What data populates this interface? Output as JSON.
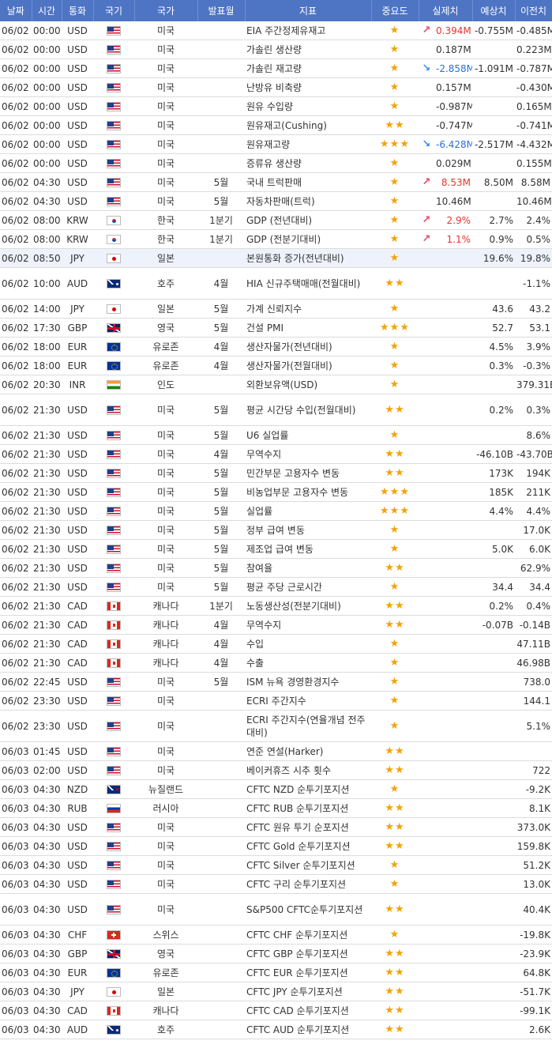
{
  "headers": {
    "date": "날짜",
    "time": "시간",
    "currency": "통화",
    "flag": "국기",
    "country": "국가",
    "period": "발표월",
    "indicator": "지표",
    "importance": "중요도",
    "actual": "실제치",
    "forecast": "예상치",
    "previous": "이전치"
  },
  "colors": {
    "header_bg": "#4e74c4",
    "star": "#f2a20a",
    "up_value": "#e8332f",
    "down_value": "#2c6fd6",
    "highlight_row": "#eef2fb"
  },
  "rows": [
    {
      "date": "06/02",
      "time": "00:00",
      "cur": "USD",
      "flag": "us",
      "flag_icon": "us-flag-icon",
      "country": "미국",
      "period": "",
      "indicator": "EIA 주간정제유재고",
      "stars": "★",
      "arrow": "↗",
      "trend": "up",
      "actual": "0.394M",
      "forecast": "-0.755M",
      "previous": "-0.485M"
    },
    {
      "date": "06/02",
      "time": "00:00",
      "cur": "USD",
      "flag": "us",
      "flag_icon": "us-flag-icon",
      "country": "미국",
      "period": "",
      "indicator": "가솔린 생산량",
      "stars": "★",
      "arrow": "",
      "trend": "",
      "actual": "0.187M",
      "forecast": "",
      "previous": "0.223M"
    },
    {
      "date": "06/02",
      "time": "00:00",
      "cur": "USD",
      "flag": "us",
      "flag_icon": "us-flag-icon",
      "country": "미국",
      "period": "",
      "indicator": "가솔린 재고량",
      "stars": "★",
      "arrow": "↘",
      "trend": "down",
      "actual": "-2.858M",
      "forecast": "-1.091M",
      "previous": "-0.787M"
    },
    {
      "date": "06/02",
      "time": "00:00",
      "cur": "USD",
      "flag": "us",
      "flag_icon": "us-flag-icon",
      "country": "미국",
      "period": "",
      "indicator": "난방유 비축량",
      "stars": "★",
      "arrow": "",
      "trend": "",
      "actual": "0.157M",
      "forecast": "",
      "previous": "-0.430M"
    },
    {
      "date": "06/02",
      "time": "00:00",
      "cur": "USD",
      "flag": "us",
      "flag_icon": "us-flag-icon",
      "country": "미국",
      "period": "",
      "indicator": "원유 수입량",
      "stars": "★",
      "arrow": "",
      "trend": "",
      "actual": "-0.987M",
      "forecast": "",
      "previous": "0.165M"
    },
    {
      "date": "06/02",
      "time": "00:00",
      "cur": "USD",
      "flag": "us",
      "flag_icon": "us-flag-icon",
      "country": "미국",
      "period": "",
      "indicator": "원유재고(Cushing)",
      "stars": "★★",
      "arrow": "",
      "trend": "",
      "actual": "-0.747M",
      "forecast": "",
      "previous": "-0.741M"
    },
    {
      "date": "06/02",
      "time": "00:00",
      "cur": "USD",
      "flag": "us",
      "flag_icon": "us-flag-icon",
      "country": "미국",
      "period": "",
      "indicator": "원유재고량",
      "stars": "★★★",
      "arrow": "↘",
      "trend": "down",
      "actual": "-6.428M",
      "forecast": "-2.517M",
      "previous": "-4.432M"
    },
    {
      "date": "06/02",
      "time": "00:00",
      "cur": "USD",
      "flag": "us",
      "flag_icon": "us-flag-icon",
      "country": "미국",
      "period": "",
      "indicator": "증류유 생산량",
      "stars": "★",
      "arrow": "",
      "trend": "",
      "actual": "0.029M",
      "forecast": "",
      "previous": "0.155M"
    },
    {
      "date": "06/02",
      "time": "04:30",
      "cur": "USD",
      "flag": "us",
      "flag_icon": "us-flag-icon",
      "country": "미국",
      "period": "5월",
      "indicator": "국내 트럭판매",
      "stars": "★",
      "arrow": "↗",
      "trend": "up",
      "actual": "8.53M",
      "forecast": "8.50M",
      "previous": "8.58M"
    },
    {
      "date": "06/02",
      "time": "04:30",
      "cur": "USD",
      "flag": "us",
      "flag_icon": "us-flag-icon",
      "country": "미국",
      "period": "5월",
      "indicator": "자동차판매(트럭)",
      "stars": "★",
      "arrow": "",
      "trend": "",
      "actual": "10.46M",
      "forecast": "",
      "previous": "10.46M"
    },
    {
      "date": "06/02",
      "time": "08:00",
      "cur": "KRW",
      "flag": "kr",
      "flag_icon": "kr-flag-icon",
      "country": "한국",
      "period": "1분기",
      "indicator": "GDP (전년대비)",
      "stars": "★",
      "arrow": "↗",
      "trend": "up",
      "actual": "2.9%",
      "forecast": "2.7%",
      "previous": "2.4%"
    },
    {
      "date": "06/02",
      "time": "08:00",
      "cur": "KRW",
      "flag": "kr",
      "flag_icon": "kr-flag-icon",
      "country": "한국",
      "period": "1분기",
      "indicator": "GDP (전분기대비)",
      "stars": "★",
      "arrow": "↗",
      "trend": "up",
      "actual": "1.1%",
      "forecast": "0.9%",
      "previous": "0.5%"
    },
    {
      "date": "06/02",
      "time": "08:50",
      "cur": "JPY",
      "flag": "jp",
      "flag_icon": "jp-flag-icon",
      "country": "일본",
      "period": "",
      "indicator": "본원통화 증가(전년대비)",
      "stars": "★",
      "arrow": "",
      "trend": "",
      "actual": "",
      "forecast": "19.6%",
      "previous": "19.8%",
      "hl": true
    },
    {
      "date": "06/02",
      "time": "10:00",
      "cur": "AUD",
      "flag": "au",
      "flag_icon": "au-flag-icon",
      "country": "호주",
      "period": "4월",
      "indicator": "HIA 신규주택매매(전월대비)",
      "stars": "★★",
      "arrow": "",
      "trend": "",
      "actual": "",
      "forecast": "",
      "previous": "-1.1%",
      "tall": true
    },
    {
      "date": "06/02",
      "time": "14:00",
      "cur": "JPY",
      "flag": "jp",
      "flag_icon": "jp-flag-icon",
      "country": "일본",
      "period": "5월",
      "indicator": "가계 신뢰지수",
      "stars": "★",
      "arrow": "",
      "trend": "",
      "actual": "",
      "forecast": "43.6",
      "previous": "43.2"
    },
    {
      "date": "06/02",
      "time": "17:30",
      "cur": "GBP",
      "flag": "gb",
      "flag_icon": "gb-flag-icon",
      "country": "영국",
      "period": "5월",
      "indicator": "건설 PMI",
      "stars": "★★★",
      "arrow": "",
      "trend": "",
      "actual": "",
      "forecast": "52.7",
      "previous": "53.1"
    },
    {
      "date": "06/02",
      "time": "18:00",
      "cur": "EUR",
      "flag": "eu",
      "flag_icon": "eu-flag-icon",
      "country": "유로존",
      "period": "4월",
      "indicator": "생산자물가(전년대비)",
      "stars": "★",
      "arrow": "",
      "trend": "",
      "actual": "",
      "forecast": "4.5%",
      "previous": "3.9%"
    },
    {
      "date": "06/02",
      "time": "18:00",
      "cur": "EUR",
      "flag": "eu",
      "flag_icon": "eu-flag-icon",
      "country": "유로존",
      "period": "4월",
      "indicator": "생산자물가(전월대비)",
      "stars": "★",
      "arrow": "",
      "trend": "",
      "actual": "",
      "forecast": "0.3%",
      "previous": "-0.3%"
    },
    {
      "date": "06/02",
      "time": "20:30",
      "cur": "INR",
      "flag": "in",
      "flag_icon": "in-flag-icon",
      "country": "인도",
      "period": "",
      "indicator": "외환보유액(USD)",
      "stars": "★",
      "arrow": "",
      "trend": "",
      "actual": "",
      "forecast": "",
      "previous": "379.31B"
    },
    {
      "date": "06/02",
      "time": "21:30",
      "cur": "USD",
      "flag": "us",
      "flag_icon": "us-flag-icon",
      "country": "미국",
      "period": "5월",
      "indicator": "평균 시간당 수입(전월대비)",
      "stars": "★★",
      "arrow": "",
      "trend": "",
      "actual": "",
      "forecast": "0.2%",
      "previous": "0.3%",
      "tall": true
    },
    {
      "date": "06/02",
      "time": "21:30",
      "cur": "USD",
      "flag": "us",
      "flag_icon": "us-flag-icon",
      "country": "미국",
      "period": "5월",
      "indicator": "U6 실업률",
      "stars": "★",
      "arrow": "",
      "trend": "",
      "actual": "",
      "forecast": "",
      "previous": "8.6%"
    },
    {
      "date": "06/02",
      "time": "21:30",
      "cur": "USD",
      "flag": "us",
      "flag_icon": "us-flag-icon",
      "country": "미국",
      "period": "4월",
      "indicator": "무역수지",
      "stars": "★★",
      "arrow": "",
      "trend": "",
      "actual": "",
      "forecast": "-46.10B",
      "previous": "-43.70B"
    },
    {
      "date": "06/02",
      "time": "21:30",
      "cur": "USD",
      "flag": "us",
      "flag_icon": "us-flag-icon",
      "country": "미국",
      "period": "5월",
      "indicator": "민간부문 고용자수 변동",
      "stars": "★★",
      "arrow": "",
      "trend": "",
      "actual": "",
      "forecast": "173K",
      "previous": "194K"
    },
    {
      "date": "06/02",
      "time": "21:30",
      "cur": "USD",
      "flag": "us",
      "flag_icon": "us-flag-icon",
      "country": "미국",
      "period": "5월",
      "indicator": "비농업부문 고용자수 변동",
      "stars": "★★★",
      "arrow": "",
      "trend": "",
      "actual": "",
      "forecast": "185K",
      "previous": "211K"
    },
    {
      "date": "06/02",
      "time": "21:30",
      "cur": "USD",
      "flag": "us",
      "flag_icon": "us-flag-icon",
      "country": "미국",
      "period": "5월",
      "indicator": "실업률",
      "stars": "★★★",
      "arrow": "",
      "trend": "",
      "actual": "",
      "forecast": "4.4%",
      "previous": "4.4%"
    },
    {
      "date": "06/02",
      "time": "21:30",
      "cur": "USD",
      "flag": "us",
      "flag_icon": "us-flag-icon",
      "country": "미국",
      "period": "5월",
      "indicator": "정부 급여 변동",
      "stars": "★",
      "arrow": "",
      "trend": "",
      "actual": "",
      "forecast": "",
      "previous": "17.0K"
    },
    {
      "date": "06/02",
      "time": "21:30",
      "cur": "USD",
      "flag": "us",
      "flag_icon": "us-flag-icon",
      "country": "미국",
      "period": "5월",
      "indicator": "제조업 급여 변동",
      "stars": "★",
      "arrow": "",
      "trend": "",
      "actual": "",
      "forecast": "5.0K",
      "previous": "6.0K"
    },
    {
      "date": "06/02",
      "time": "21:30",
      "cur": "USD",
      "flag": "us",
      "flag_icon": "us-flag-icon",
      "country": "미국",
      "period": "5월",
      "indicator": "참여율",
      "stars": "★★",
      "arrow": "",
      "trend": "",
      "actual": "",
      "forecast": "",
      "previous": "62.9%"
    },
    {
      "date": "06/02",
      "time": "21:30",
      "cur": "USD",
      "flag": "us",
      "flag_icon": "us-flag-icon",
      "country": "미국",
      "period": "5월",
      "indicator": "평균 주당 근로시간",
      "stars": "★",
      "arrow": "",
      "trend": "",
      "actual": "",
      "forecast": "34.4",
      "previous": "34.4"
    },
    {
      "date": "06/02",
      "time": "21:30",
      "cur": "CAD",
      "flag": "ca",
      "flag_icon": "ca-flag-icon",
      "country": "캐나다",
      "period": "1분기",
      "indicator": "노동생산성(전분기대비)",
      "stars": "★★",
      "arrow": "",
      "trend": "",
      "actual": "",
      "forecast": "0.2%",
      "previous": "0.4%"
    },
    {
      "date": "06/02",
      "time": "21:30",
      "cur": "CAD",
      "flag": "ca",
      "flag_icon": "ca-flag-icon",
      "country": "캐나다",
      "period": "4월",
      "indicator": "무역수지",
      "stars": "★★",
      "arrow": "",
      "trend": "",
      "actual": "",
      "forecast": "-0.07B",
      "previous": "-0.14B"
    },
    {
      "date": "06/02",
      "time": "21:30",
      "cur": "CAD",
      "flag": "ca",
      "flag_icon": "ca-flag-icon",
      "country": "캐나다",
      "period": "4월",
      "indicator": "수입",
      "stars": "★",
      "arrow": "",
      "trend": "",
      "actual": "",
      "forecast": "",
      "previous": "47.11B"
    },
    {
      "date": "06/02",
      "time": "21:30",
      "cur": "CAD",
      "flag": "ca",
      "flag_icon": "ca-flag-icon",
      "country": "캐나다",
      "period": "4월",
      "indicator": "수출",
      "stars": "★",
      "arrow": "",
      "trend": "",
      "actual": "",
      "forecast": "",
      "previous": "46.98B"
    },
    {
      "date": "06/02",
      "time": "22:45",
      "cur": "USD",
      "flag": "us",
      "flag_icon": "us-flag-icon",
      "country": "미국",
      "period": "5월",
      "indicator": "ISM 뉴욕 경영환경지수",
      "stars": "★",
      "arrow": "",
      "trend": "",
      "actual": "",
      "forecast": "",
      "previous": "738.0"
    },
    {
      "date": "06/02",
      "time": "23:30",
      "cur": "USD",
      "flag": "us",
      "flag_icon": "us-flag-icon",
      "country": "미국",
      "period": "",
      "indicator": "ECRI 주간지수",
      "stars": "★",
      "arrow": "",
      "trend": "",
      "actual": "",
      "forecast": "",
      "previous": "144.1"
    },
    {
      "date": "06/02",
      "time": "23:30",
      "cur": "USD",
      "flag": "us",
      "flag_icon": "us-flag-icon",
      "country": "미국",
      "period": "",
      "indicator": "ECRI 주간지수(연율개념 전주대비)",
      "stars": "★",
      "arrow": "",
      "trend": "",
      "actual": "",
      "forecast": "",
      "previous": "5.1%",
      "tall": true
    },
    {
      "date": "06/03",
      "time": "01:45",
      "cur": "USD",
      "flag": "us",
      "flag_icon": "us-flag-icon",
      "country": "미국",
      "period": "",
      "indicator": "연준 연설(Harker)",
      "stars": "★★",
      "arrow": "",
      "trend": "",
      "actual": "",
      "forecast": "",
      "previous": ""
    },
    {
      "date": "06/03",
      "time": "02:00",
      "cur": "USD",
      "flag": "us",
      "flag_icon": "us-flag-icon",
      "country": "미국",
      "period": "",
      "indicator": "베이커휴즈 시추 횟수",
      "stars": "★★",
      "arrow": "",
      "trend": "",
      "actual": "",
      "forecast": "",
      "previous": "722"
    },
    {
      "date": "06/03",
      "time": "04:30",
      "cur": "NZD",
      "flag": "nz",
      "flag_icon": "nz-flag-icon",
      "country": "뉴질랜드",
      "period": "",
      "indicator": "CFTC NZD 순투기포지션",
      "stars": "★",
      "arrow": "",
      "trend": "",
      "actual": "",
      "forecast": "",
      "previous": "-9.2K"
    },
    {
      "date": "06/03",
      "time": "04:30",
      "cur": "RUB",
      "flag": "ru",
      "flag_icon": "ru-flag-icon",
      "country": "러시아",
      "period": "",
      "indicator": "CFTC RUB 순투기포지션",
      "stars": "★★",
      "arrow": "",
      "trend": "",
      "actual": "",
      "forecast": "",
      "previous": "8.1K"
    },
    {
      "date": "06/03",
      "time": "04:30",
      "cur": "USD",
      "flag": "us",
      "flag_icon": "us-flag-icon",
      "country": "미국",
      "period": "",
      "indicator": "CFTC 원유 투기 순포지션",
      "stars": "★★",
      "arrow": "",
      "trend": "",
      "actual": "",
      "forecast": "",
      "previous": "373.0K"
    },
    {
      "date": "06/03",
      "time": "04:30",
      "cur": "USD",
      "flag": "us",
      "flag_icon": "us-flag-icon",
      "country": "미국",
      "period": "",
      "indicator": "CFTC Gold 순투기포지션",
      "stars": "★★",
      "arrow": "",
      "trend": "",
      "actual": "",
      "forecast": "",
      "previous": "159.8K"
    },
    {
      "date": "06/03",
      "time": "04:30",
      "cur": "USD",
      "flag": "us",
      "flag_icon": "us-flag-icon",
      "country": "미국",
      "period": "",
      "indicator": "CFTC Silver 순투기포지션",
      "stars": "★",
      "arrow": "",
      "trend": "",
      "actual": "",
      "forecast": "",
      "previous": "51.2K"
    },
    {
      "date": "06/03",
      "time": "04:30",
      "cur": "USD",
      "flag": "us",
      "flag_icon": "us-flag-icon",
      "country": "미국",
      "period": "",
      "indicator": "CFTC 구리 순투기포지션",
      "stars": "★",
      "arrow": "",
      "trend": "",
      "actual": "",
      "forecast": "",
      "previous": "13.0K"
    },
    {
      "date": "06/03",
      "time": "04:30",
      "cur": "USD",
      "flag": "us",
      "flag_icon": "us-flag-icon",
      "country": "미국",
      "period": "",
      "indicator": "S&P500 CFTC순투기포지션",
      "stars": "★★",
      "arrow": "",
      "trend": "",
      "actual": "",
      "forecast": "",
      "previous": "40.4K",
      "tall": true
    },
    {
      "date": "06/03",
      "time": "04:30",
      "cur": "CHF",
      "flag": "ch",
      "flag_icon": "ch-flag-icon",
      "country": "스위스",
      "period": "",
      "indicator": "CFTC CHF 순투기포지션",
      "stars": "★",
      "arrow": "",
      "trend": "",
      "actual": "",
      "forecast": "",
      "previous": "-19.8K"
    },
    {
      "date": "06/03",
      "time": "04:30",
      "cur": "GBP",
      "flag": "gb",
      "flag_icon": "gb-flag-icon",
      "country": "영국",
      "period": "",
      "indicator": "CFTC GBP 순투기포지션",
      "stars": "★★",
      "arrow": "",
      "trend": "",
      "actual": "",
      "forecast": "",
      "previous": "-23.9K"
    },
    {
      "date": "06/03",
      "time": "04:30",
      "cur": "EUR",
      "flag": "eu",
      "flag_icon": "eu-flag-icon",
      "country": "유로존",
      "period": "",
      "indicator": "CFTC EUR 순투기포지션",
      "stars": "★★",
      "arrow": "",
      "trend": "",
      "actual": "",
      "forecast": "",
      "previous": "64.8K"
    },
    {
      "date": "06/03",
      "time": "04:30",
      "cur": "JPY",
      "flag": "jp",
      "flag_icon": "jp-flag-icon",
      "country": "일본",
      "period": "",
      "indicator": "CFTC JPY 순투기포지션",
      "stars": "★★",
      "arrow": "",
      "trend": "",
      "actual": "",
      "forecast": "",
      "previous": "-51.7K"
    },
    {
      "date": "06/03",
      "time": "04:30",
      "cur": "CAD",
      "flag": "ca",
      "flag_icon": "ca-flag-icon",
      "country": "캐나다",
      "period": "",
      "indicator": "CFTC CAD 순투기포지션",
      "stars": "★★",
      "arrow": "",
      "trend": "",
      "actual": "",
      "forecast": "",
      "previous": "-99.1K"
    },
    {
      "date": "06/03",
      "time": "04:30",
      "cur": "AUD",
      "flag": "au",
      "flag_icon": "au-flag-icon",
      "country": "호주",
      "period": "",
      "indicator": "CFTC AUD 순투기포지션",
      "stars": "★★",
      "arrow": "",
      "trend": "",
      "actual": "",
      "forecast": "",
      "previous": "2.6K"
    }
  ]
}
